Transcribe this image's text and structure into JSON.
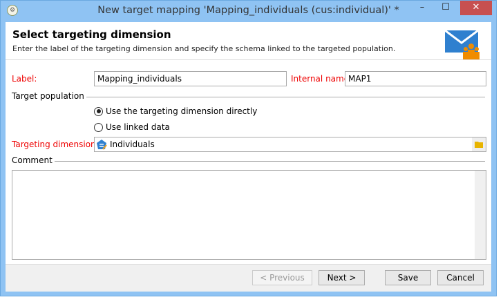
{
  "window": {
    "title": "New target mapping 'Mapping_individuals (cus:individual)' *",
    "minimize": "–",
    "maximize": "☐",
    "close": "✕"
  },
  "header": {
    "title": "Select targeting dimension",
    "subtitle": "Enter the label of the targeting dimension and specify the schema linked to the targeted population."
  },
  "form": {
    "label_label": "Label:",
    "label_value": "Mapping_individuals",
    "internal_name_label": "Internal name:",
    "internal_name_value": "MAP1",
    "target_population": "Target population",
    "radio_direct": "Use the targeting dimension directly",
    "radio_linked": "Use linked data",
    "targeting_dimension_label": "Targeting dimension:",
    "targeting_dimension_value": "Individuals",
    "comment_label": "Comment",
    "comment_value": ""
  },
  "footer": {
    "previous": "< Previous",
    "next": "Next >",
    "save": "Save",
    "cancel": "Cancel"
  }
}
